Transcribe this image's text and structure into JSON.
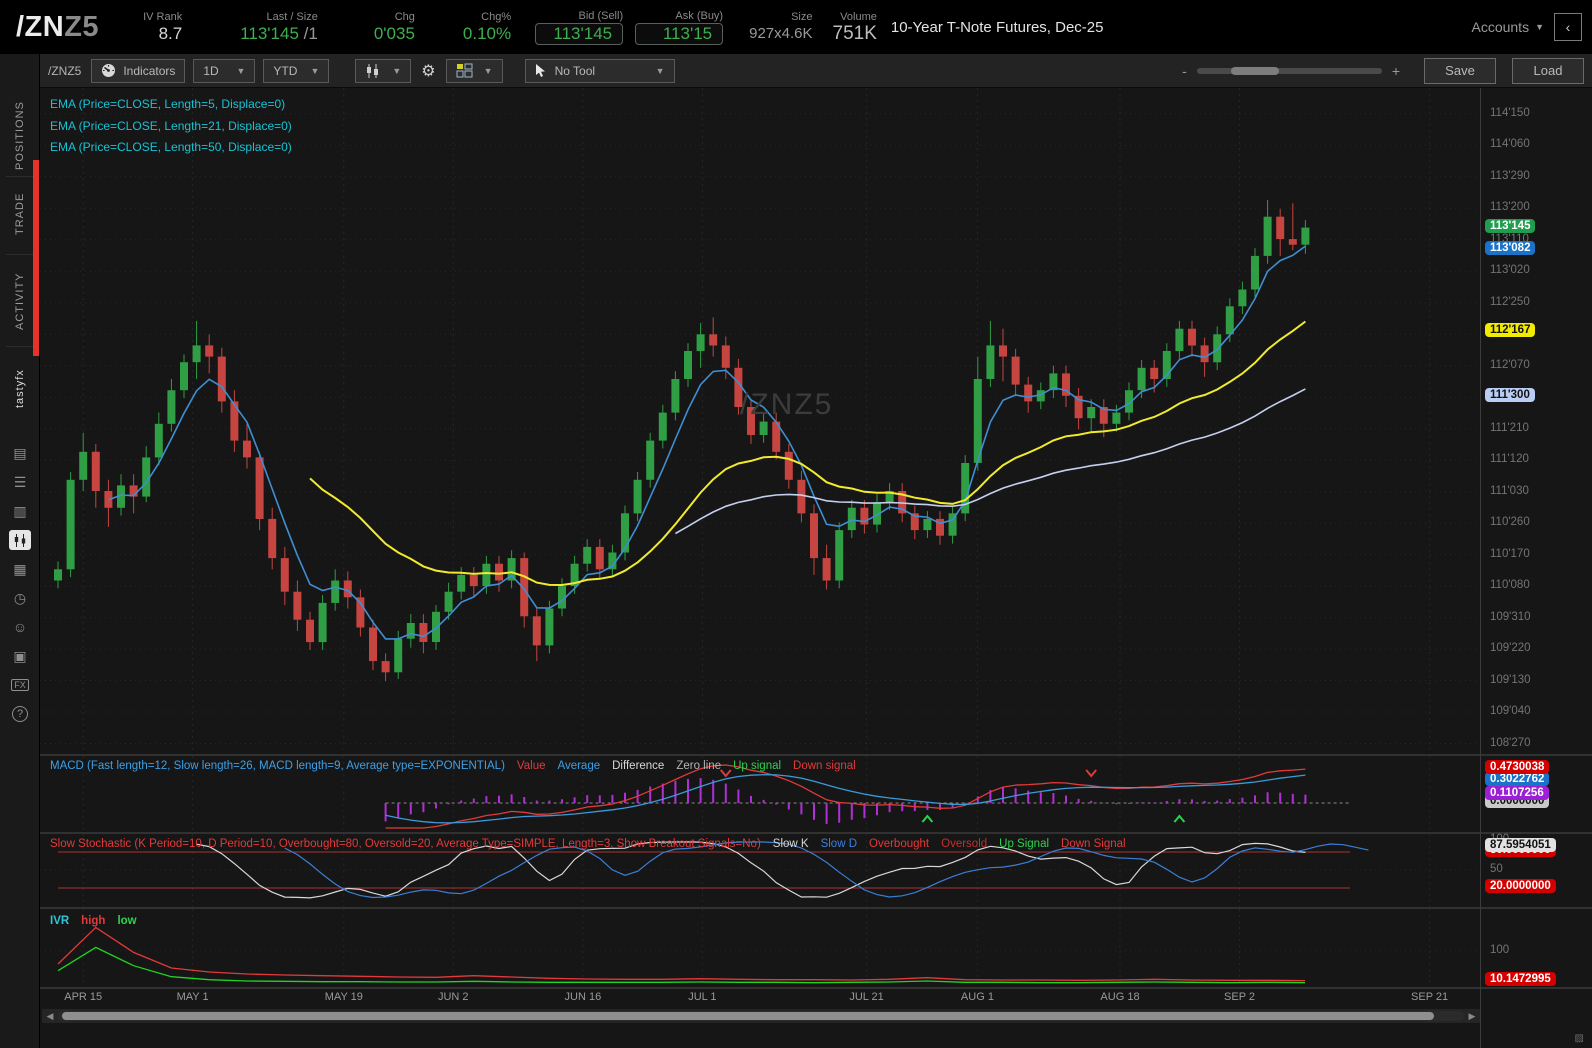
{
  "header": {
    "symbol_main": "/ZN",
    "symbol_suffix": "Z5",
    "iv_rank": {
      "label": "IV Rank",
      "value": "8.7"
    },
    "last_size": {
      "label": "Last / Size",
      "value": "113'145",
      "suffix": " /1"
    },
    "chg": {
      "label": "Chg",
      "value": "0'035"
    },
    "chg_pct": {
      "label": "Chg%",
      "value": "0.10%"
    },
    "bid": {
      "label": "Bid (Sell)",
      "value": "113'145"
    },
    "ask": {
      "label": "Ask (Buy)",
      "value": "113'15"
    },
    "size": {
      "label": "Size",
      "value": "927x4.6K"
    },
    "volume": {
      "label": "Volume",
      "value": "751K"
    },
    "description": "10-Year T-Note Futures, Dec-25",
    "accounts_label": "Accounts",
    "collapse_glyph": "‹"
  },
  "toolbar": {
    "symbol": "/ZNZ5",
    "indicators_label": "Indicators",
    "timeframe": "1D",
    "range": "YTD",
    "tool_label": "No Tool",
    "zoom_minus": "-",
    "zoom_plus": "+",
    "save_label": "Save",
    "load_label": "Load"
  },
  "sidebar": {
    "tabs": [
      {
        "label": "POSITIONS"
      },
      {
        "label": "TRADE"
      },
      {
        "label": "ACTIVITY"
      },
      {
        "label": "tastyfx"
      }
    ],
    "icons": [
      {
        "name": "journal-icon",
        "glyph": "▤"
      },
      {
        "name": "watchlist-icon",
        "glyph": "☰"
      },
      {
        "name": "orders-icon",
        "glyph": "▥"
      },
      {
        "name": "chart-icon",
        "glyph": "▮",
        "active": true
      },
      {
        "name": "apps-grid-icon",
        "glyph": "▦"
      },
      {
        "name": "history-icon",
        "glyph": "◷"
      },
      {
        "name": "follow-traders-icon",
        "glyph": "☺"
      },
      {
        "name": "calendar-icon",
        "glyph": "▣"
      },
      {
        "name": "futures-fx-icon",
        "glyph": "FX"
      },
      {
        "name": "help-icon",
        "glyph": "?"
      }
    ]
  },
  "chart_data": {
    "type": "candlestick-with-indicators",
    "watermark": "/ZNZ5",
    "title": "10-Year T-Note Futures, Dec-25",
    "price_range": [
      108.75,
      114.7
    ],
    "ema_legend": [
      "EMA (Price=CLOSE, Length=5, Displace=0)",
      "EMA (Price=CLOSE, Length=21, Displace=0)",
      "EMA (Price=CLOSE, Length=50, Displace=0)"
    ],
    "ema_lengths": [
      5,
      21,
      50
    ],
    "ema_colors": [
      "#3f8fd2",
      "#f2ea2d",
      "#c4d0ee"
    ],
    "candles_ohlc": [
      [
        110.3,
        110.47,
        110.23,
        110.4
      ],
      [
        110.4,
        111.27,
        110.33,
        111.2
      ],
      [
        111.2,
        111.62,
        111.1,
        111.45
      ],
      [
        111.45,
        111.52,
        110.95,
        111.1
      ],
      [
        111.1,
        111.2,
        110.78,
        110.95
      ],
      [
        110.95,
        111.25,
        110.88,
        111.15
      ],
      [
        111.15,
        111.25,
        110.9,
        111.05
      ],
      [
        111.05,
        111.5,
        111.0,
        111.4
      ],
      [
        111.4,
        111.8,
        111.33,
        111.7
      ],
      [
        111.7,
        112.1,
        111.63,
        112.0
      ],
      [
        112.0,
        112.32,
        111.93,
        112.25
      ],
      [
        112.25,
        112.62,
        112.1,
        112.4
      ],
      [
        112.4,
        112.5,
        112.15,
        112.3
      ],
      [
        112.3,
        112.38,
        111.8,
        111.9
      ],
      [
        111.9,
        112.0,
        111.45,
        111.55
      ],
      [
        111.55,
        111.7,
        111.3,
        111.4
      ],
      [
        111.4,
        111.45,
        110.75,
        110.85
      ],
      [
        110.85,
        110.95,
        110.4,
        110.5
      ],
      [
        110.5,
        110.6,
        110.08,
        110.2
      ],
      [
        110.2,
        110.3,
        109.85,
        109.95
      ],
      [
        109.95,
        110.02,
        109.68,
        109.75
      ],
      [
        109.75,
        110.17,
        109.68,
        110.1
      ],
      [
        110.1,
        110.4,
        110.03,
        110.3
      ],
      [
        110.3,
        110.38,
        110.05,
        110.15
      ],
      [
        110.15,
        110.22,
        109.8,
        109.88
      ],
      [
        109.88,
        109.95,
        109.5,
        109.58
      ],
      [
        109.58,
        109.65,
        109.4,
        109.48
      ],
      [
        109.48,
        109.85,
        109.42,
        109.78
      ],
      [
        109.78,
        110.0,
        109.7,
        109.92
      ],
      [
        109.92,
        110.0,
        109.65,
        109.75
      ],
      [
        109.75,
        110.08,
        109.68,
        110.02
      ],
      [
        110.02,
        110.28,
        109.95,
        110.2
      ],
      [
        110.2,
        110.42,
        110.13,
        110.35
      ],
      [
        110.35,
        110.42,
        110.15,
        110.25
      ],
      [
        110.25,
        110.52,
        110.18,
        110.45
      ],
      [
        110.45,
        110.52,
        110.2,
        110.3
      ],
      [
        110.3,
        110.57,
        110.23,
        110.5
      ],
      [
        110.5,
        110.55,
        109.88,
        109.98
      ],
      [
        109.98,
        110.05,
        109.58,
        109.72
      ],
      [
        109.72,
        110.12,
        109.65,
        110.05
      ],
      [
        110.05,
        110.32,
        109.98,
        110.25
      ],
      [
        110.25,
        110.52,
        110.18,
        110.45
      ],
      [
        110.45,
        110.67,
        110.38,
        110.6
      ],
      [
        110.6,
        110.67,
        110.32,
        110.4
      ],
      [
        110.4,
        110.62,
        110.33,
        110.55
      ],
      [
        110.55,
        110.97,
        110.48,
        110.9
      ],
      [
        110.9,
        111.27,
        110.83,
        111.2
      ],
      [
        111.2,
        111.62,
        111.13,
        111.55
      ],
      [
        111.55,
        111.87,
        111.48,
        111.8
      ],
      [
        111.8,
        112.17,
        111.73,
        112.1
      ],
      [
        112.1,
        112.42,
        112.03,
        112.35
      ],
      [
        112.35,
        112.6,
        112.2,
        112.5
      ],
      [
        112.5,
        112.65,
        112.3,
        112.4
      ],
      [
        112.4,
        112.48,
        112.1,
        112.2
      ],
      [
        112.2,
        112.28,
        111.78,
        111.85
      ],
      [
        111.85,
        111.92,
        111.52,
        111.6
      ],
      [
        111.6,
        111.8,
        111.53,
        111.72
      ],
      [
        111.72,
        111.8,
        111.38,
        111.45
      ],
      [
        111.45,
        111.52,
        111.12,
        111.2
      ],
      [
        111.2,
        111.28,
        110.82,
        110.9
      ],
      [
        110.9,
        110.98,
        110.35,
        110.5
      ],
      [
        110.5,
        110.62,
        110.22,
        110.3
      ],
      [
        110.3,
        110.82,
        110.23,
        110.75
      ],
      [
        110.75,
        111.02,
        110.68,
        110.95
      ],
      [
        110.95,
        111.02,
        110.72,
        110.8
      ],
      [
        110.8,
        111.07,
        110.73,
        111.0
      ],
      [
        111.0,
        111.17,
        110.93,
        111.1
      ],
      [
        111.1,
        111.17,
        110.82,
        110.9
      ],
      [
        110.9,
        110.97,
        110.67,
        110.75
      ],
      [
        110.75,
        110.92,
        110.68,
        110.85
      ],
      [
        110.85,
        110.92,
        110.62,
        110.7
      ],
      [
        110.7,
        110.97,
        110.63,
        110.9
      ],
      [
        110.9,
        111.42,
        110.83,
        111.35
      ],
      [
        111.35,
        112.3,
        111.28,
        112.1
      ],
      [
        112.1,
        112.62,
        112.03,
        112.4
      ],
      [
        112.4,
        112.55,
        112.08,
        112.3
      ],
      [
        112.3,
        112.37,
        111.95,
        112.05
      ],
      [
        112.05,
        112.12,
        111.8,
        111.9
      ],
      [
        111.9,
        112.07,
        111.83,
        112.0
      ],
      [
        112.0,
        112.22,
        111.93,
        112.15
      ],
      [
        112.15,
        112.22,
        111.85,
        111.95
      ],
      [
        111.95,
        112.02,
        111.65,
        111.75
      ],
      [
        111.75,
        111.92,
        111.62,
        111.85
      ],
      [
        111.85,
        111.92,
        111.58,
        111.7
      ],
      [
        111.7,
        111.87,
        111.63,
        111.8
      ],
      [
        111.8,
        112.07,
        111.73,
        112.0
      ],
      [
        112.0,
        112.27,
        111.93,
        112.2
      ],
      [
        112.2,
        112.27,
        111.98,
        112.1
      ],
      [
        112.1,
        112.42,
        112.03,
        112.35
      ],
      [
        112.35,
        112.62,
        112.28,
        112.55
      ],
      [
        112.55,
        112.62,
        112.3,
        112.4
      ],
      [
        112.4,
        112.47,
        112.12,
        112.25
      ],
      [
        112.25,
        112.57,
        112.18,
        112.5
      ],
      [
        112.5,
        112.82,
        112.43,
        112.75
      ],
      [
        112.75,
        112.97,
        112.68,
        112.9
      ],
      [
        112.9,
        113.27,
        112.83,
        113.2
      ],
      [
        113.2,
        113.7,
        113.13,
        113.55
      ],
      [
        113.55,
        113.62,
        113.2,
        113.35
      ],
      [
        113.35,
        113.67,
        113.25,
        113.3
      ],
      [
        113.3,
        113.52,
        113.22,
        113.453
      ]
    ],
    "candle_up_color": "#2f9e44",
    "candle_down_color": "#c64540",
    "x_axis": {
      "labels": [
        {
          "text": "APR 15",
          "frac": 0.03
        },
        {
          "text": "MAY 1",
          "frac": 0.106
        },
        {
          "text": "MAY 19",
          "frac": 0.211
        },
        {
          "text": "JUN 2",
          "frac": 0.287
        },
        {
          "text": "JUN 16",
          "frac": 0.377
        },
        {
          "text": "JUL 1",
          "frac": 0.46
        },
        {
          "text": "JUL 21",
          "frac": 0.574
        },
        {
          "text": "AUG 1",
          "frac": 0.651
        },
        {
          "text": "AUG 18",
          "frac": 0.75
        },
        {
          "text": "SEP 2",
          "frac": 0.833
        },
        {
          "text": "SEP 21",
          "frac": 0.965
        }
      ]
    },
    "y_axis": {
      "ticks": [
        {
          "label": "114'150",
          "price": 114.46875
        },
        {
          "label": "114'060",
          "price": 114.1875
        },
        {
          "label": "113'290",
          "price": 113.90625
        },
        {
          "label": "113'200",
          "price": 113.625
        },
        {
          "label": "113'110",
          "price": 113.34375
        },
        {
          "label": "113'020",
          "price": 113.0625
        },
        {
          "label": "112'250",
          "price": 112.78125
        },
        {
          "label": "112'160",
          "price": 112.5
        },
        {
          "label": "112'070",
          "price": 112.21875
        },
        {
          "label": "111'300",
          "price": 111.9375
        },
        {
          "label": "111'210",
          "price": 111.65625
        },
        {
          "label": "111'120",
          "price": 111.375
        },
        {
          "label": "111'030",
          "price": 111.09375
        },
        {
          "label": "110'260",
          "price": 110.8125
        },
        {
          "label": "110'170",
          "price": 110.53125
        },
        {
          "label": "110'080",
          "price": 110.25
        },
        {
          "label": "109'310",
          "price": 109.96875
        },
        {
          "label": "109'220",
          "price": 109.6875
        },
        {
          "label": "109'130",
          "price": 109.40625
        },
        {
          "label": "109'040",
          "price": 109.125
        },
        {
          "label": "108'270",
          "price": 108.84375
        }
      ],
      "badges": [
        {
          "label": "111'300",
          "price": 111.9375,
          "bg": "#b9cdf5",
          "fg": "#111"
        },
        {
          "label": "112'167",
          "price": 112.5219,
          "bg": "#f2ea00",
          "fg": "#111"
        },
        {
          "label": "113'082",
          "price": 113.2563,
          "bg": "#1a73c8",
          "fg": "#fff"
        },
        {
          "label": "113'145",
          "price": 113.4531,
          "bg": "#1e9e4e",
          "fg": "#fff"
        }
      ]
    },
    "macd": {
      "legend": [
        {
          "t": "MACD (Fast length=12, Slow length=26, MACD length=9, Average type=EXPONENTIAL)",
          "c": "#3da0e8"
        },
        {
          "t": "Value",
          "c": "#e23a3a"
        },
        {
          "t": "Average",
          "c": "#3da0e8"
        },
        {
          "t": "Difference",
          "c": "#d8d8d8"
        },
        {
          "t": "Zero line",
          "c": "#b5b5b5"
        },
        {
          "t": "Up signal",
          "c": "#2fd14f"
        },
        {
          "t": "Down signal",
          "c": "#e23a3a"
        }
      ],
      "fast": 12,
      "slow": 26,
      "signal": 9,
      "up_signal_indices": [
        69,
        89
      ],
      "down_signal_indices": [
        53,
        82
      ],
      "value_color": "#e23a3a",
      "average_color": "#3b9ad9",
      "histogram_color": "#b02fd6",
      "badges": [
        {
          "label": "0.0000000",
          "value": 0.0,
          "bg": "#c9c9c9",
          "fg": "#111"
        },
        {
          "label": "0.3022762",
          "value": 0.3022762,
          "bg": "#1a73c8",
          "fg": "#fff"
        },
        {
          "label": "0.1107256",
          "value": 0.1107256,
          "bg": "#9b1fd4",
          "fg": "#fff"
        },
        {
          "label": "0.4730038",
          "value": 0.4730038,
          "bg": "#d40000",
          "fg": "#fff"
        }
      ]
    },
    "stochastic": {
      "legend": [
        {
          "t": "Slow Stochastic (K Period=10, D Period=10, Overbought=80, Oversold=20, Average Type=SIMPLE, Length=3, Show Breakout Signals=No)",
          "c": "#e23a3a"
        },
        {
          "t": "Slow K",
          "c": "#d8d8d8"
        },
        {
          "t": "Slow D",
          "c": "#3d7fe0"
        },
        {
          "t": "Overbought",
          "c": "#e23a3a"
        },
        {
          "t": "Oversold",
          "c": "#c03030"
        },
        {
          "t": "Up Signal",
          "c": "#2fd14f"
        },
        {
          "t": "Down Signal",
          "c": "#e23a3a"
        }
      ],
      "k_period": 10,
      "d_period": 10,
      "overbought": 80,
      "oversold": 20,
      "k_color": "#d8d8d8",
      "d_color": "#3b7fd4",
      "band_color": "#a83232",
      "ticks": [
        {
          "label": "100",
          "value": 100
        },
        {
          "label": "50",
          "value": 50
        }
      ],
      "badges": [
        {
          "label": "80.0000000",
          "value": 80,
          "bg": "#d40000",
          "fg": "#fff"
        },
        {
          "label": "87.5954051",
          "value": 87.5954051,
          "bg": "#e2e2e2",
          "fg": "#111"
        },
        {
          "label": "20.0000000",
          "value": 20,
          "bg": "#d40000",
          "fg": "#fff"
        }
      ]
    },
    "ivr": {
      "legend": [
        {
          "t": "IVR",
          "c": "#2bc6d9"
        },
        {
          "t": "high",
          "c": "#e23a3a"
        },
        {
          "t": "low",
          "c": "#2fd14f"
        }
      ],
      "high_color": "#e23a3a",
      "low_color": "#21d421",
      "high_series": [
        60,
        170,
        95,
        48,
        36,
        30,
        27,
        25,
        23,
        21,
        20,
        25,
        21,
        17,
        15,
        14,
        14,
        16,
        14,
        13,
        13,
        12,
        14,
        19,
        13,
        12,
        12,
        11,
        12,
        14,
        12,
        11,
        11,
        10.1
      ],
      "low_series": [
        40,
        110,
        55,
        22,
        13,
        9,
        8,
        7,
        7,
        6,
        6,
        8,
        6,
        5,
        5,
        5,
        5,
        6,
        5,
        5,
        4,
        5,
        6,
        9,
        5,
        5,
        4,
        4,
        5,
        6,
        5,
        4,
        5,
        4
      ],
      "ticks": [
        {
          "label": "100",
          "value": 100
        }
      ],
      "badges": [
        {
          "label": "10.1472995",
          "value": 10.1472995,
          "bg": "#d40000",
          "fg": "#fff"
        }
      ]
    }
  }
}
